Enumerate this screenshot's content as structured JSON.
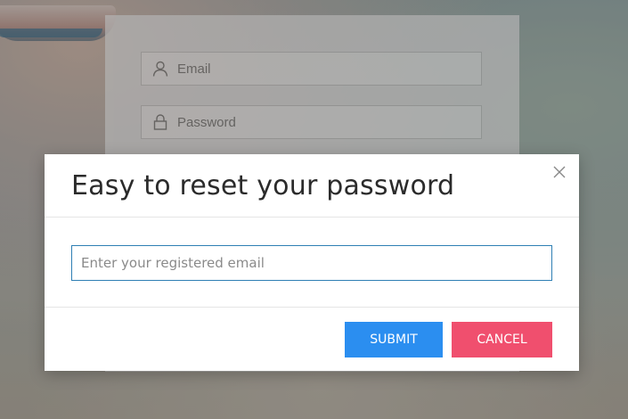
{
  "login_form": {
    "email_label": "Email",
    "password_label": "Password",
    "email_icon": "user-icon",
    "password_icon": "lock-icon"
  },
  "modal": {
    "title": "Easy to reset your password",
    "close_icon": "close-icon",
    "email_placeholder": "Enter your registered email",
    "email_value": "",
    "submit_label": "SUBMIT",
    "cancel_label": "CANCEL"
  },
  "colors": {
    "submit": "#2b8ef0",
    "cancel": "#f04f6e",
    "input_border": "#2f7fb4"
  }
}
